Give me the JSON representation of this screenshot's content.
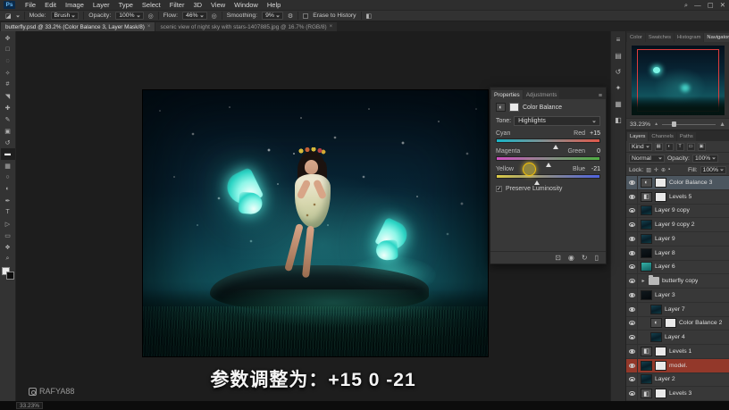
{
  "titlebar": {
    "logo": "Ps",
    "controls": [
      "—",
      "▢",
      "✕"
    ],
    "search_icon": "⌕"
  },
  "menubar": {
    "items": [
      "File",
      "Edit",
      "Image",
      "Layer",
      "Type",
      "Select",
      "Filter",
      "3D",
      "View",
      "Window",
      "Help"
    ]
  },
  "options": {
    "eraser_icon": "◪",
    "mode_label": "Mode:",
    "mode_value": "Brush",
    "opacity_label": "Opacity:",
    "opacity_value": "100%",
    "flow_label": "Flow:",
    "flow_value": "46%",
    "pressure_icon": "◎",
    "smoothing_label": "Smoothing:",
    "smoothing_value": "9%",
    "gear_icon": "⚙",
    "erase_to_history_label": "Erase to History",
    "mask_icon": "◧"
  },
  "tabs": {
    "active": "butterfly.psd @ 33.2% (Color Balance 3, Layer Mask/8)",
    "inactive": "scenic view of night sky with stars-1407885.jpg @ 16.7% (RGB/8)",
    "close": "×"
  },
  "toolbar": {
    "collapse_icon": "»",
    "tools": [
      {
        "name": "move-tool",
        "glyph": "✥"
      },
      {
        "name": "marquee-tool",
        "glyph": "□"
      },
      {
        "name": "lasso-tool",
        "glyph": "◌"
      },
      {
        "name": "quick-selection-tool",
        "glyph": "✧"
      },
      {
        "name": "crop-tool",
        "glyph": "#"
      },
      {
        "name": "eyedropper-tool",
        "glyph": "◥"
      },
      {
        "name": "healing-brush-tool",
        "glyph": "✚"
      },
      {
        "name": "brush-tool",
        "glyph": "✎"
      },
      {
        "name": "clone-stamp-tool",
        "glyph": "▣"
      },
      {
        "name": "history-brush-tool",
        "glyph": "↺"
      },
      {
        "name": "eraser-tool",
        "glyph": "▬"
      },
      {
        "name": "gradient-tool",
        "glyph": "▦"
      },
      {
        "name": "blur-tool",
        "glyph": "○"
      },
      {
        "name": "dodge-tool",
        "glyph": "◐"
      },
      {
        "name": "pen-tool",
        "glyph": "✒"
      },
      {
        "name": "type-tool",
        "glyph": "T"
      },
      {
        "name": "path-selection-tool",
        "glyph": "▷"
      },
      {
        "name": "shape-tool",
        "glyph": "▭"
      },
      {
        "name": "hand-tool",
        "glyph": "❖"
      },
      {
        "name": "zoom-tool",
        "glyph": "⌕"
      }
    ]
  },
  "canvas": {
    "caption": "参数调整为：+15 0 -21",
    "watermark": "RAFYA88"
  },
  "dock_strip": {
    "icons": [
      "≡",
      "▤",
      "↺",
      "✦",
      "▦",
      "◧"
    ]
  },
  "navigator": {
    "tabs": [
      "Color",
      "Swatches",
      "Histogram",
      "Navigator"
    ],
    "zoom": "33.23%"
  },
  "properties": {
    "tabs": [
      "Properties",
      "Adjustments"
    ],
    "menu_icon": "≡",
    "adjustment_icon": "◐",
    "title": "Color Balance",
    "tone_label": "Tone:",
    "tone_value": "Highlights",
    "sliders": [
      {
        "left_label": "Cyan",
        "right_label": "Red",
        "value": "+15"
      },
      {
        "left_label": "Magenta",
        "right_label": "Green",
        "value": "0"
      },
      {
        "left_label": "Yellow",
        "right_label": "Blue",
        "value": "-21"
      }
    ],
    "preserve_luminosity_label": "Preserve Luminosity",
    "check_glyph": "✓",
    "footer_icons": [
      "⊡",
      "◉",
      "↻",
      "▯"
    ]
  },
  "layers_panel": {
    "tabs": [
      "Layers",
      "Channels",
      "Paths"
    ],
    "filter_label": "Kind",
    "filter_icons": [
      "▦",
      "◐",
      "T",
      "▭",
      "▣"
    ],
    "blend_mode": "Normal",
    "opacity_label": "Opacity:",
    "opacity_value": "100%",
    "lock_label": "Lock:",
    "lock_icons": [
      "▨",
      "✛",
      "⊕",
      "▪"
    ],
    "fill_label": "Fill:",
    "fill_value": "100%",
    "layers": [
      {
        "name": "Color Balance 3"
      },
      {
        "name": "Levels 5"
      },
      {
        "name": "Layer 9 copy"
      },
      {
        "name": "Layer 9 copy 2"
      },
      {
        "name": "Layer 9"
      },
      {
        "name": "Layer 8"
      },
      {
        "name": "Layer 6"
      },
      {
        "name": "butterfly copy"
      },
      {
        "name": "Layer 3"
      },
      {
        "name": "Layer 7"
      },
      {
        "name": "Color Balance 2"
      },
      {
        "name": "Layer 4"
      },
      {
        "name": "Levels 1"
      },
      {
        "name": "model."
      },
      {
        "name": "Layer 2"
      },
      {
        "name": "Levels 3"
      }
    ]
  },
  "statusbar": {
    "zoom": "33.23%"
  }
}
